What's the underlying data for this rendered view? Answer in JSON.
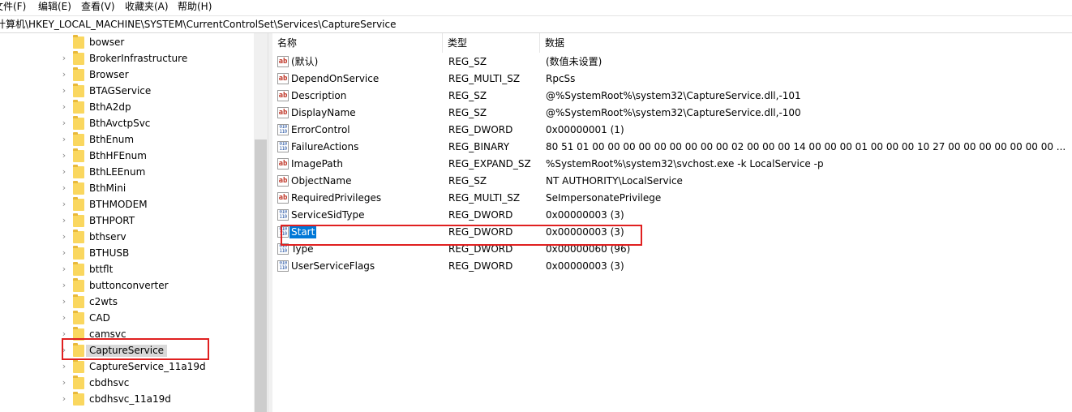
{
  "menu": [
    {
      "label": "文件(F)"
    },
    {
      "label": "编辑(E)"
    },
    {
      "label": "查看(V)"
    },
    {
      "label": "收藏夹(A)"
    },
    {
      "label": "帮助(H)"
    }
  ],
  "address_path": "计算机\\HKEY_LOCAL_MACHINE\\SYSTEM\\CurrentControlSet\\Services\\CaptureService",
  "tree": {
    "items": [
      {
        "label": "bowser",
        "expandable": false
      },
      {
        "label": "BrokerInfrastructure",
        "expandable": true
      },
      {
        "label": "Browser",
        "expandable": true
      },
      {
        "label": "BTAGService",
        "expandable": true
      },
      {
        "label": "BthA2dp",
        "expandable": true
      },
      {
        "label": "BthAvctpSvc",
        "expandable": true
      },
      {
        "label": "BthEnum",
        "expandable": true
      },
      {
        "label": "BthHFEnum",
        "expandable": true
      },
      {
        "label": "BthLEEnum",
        "expandable": true
      },
      {
        "label": "BthMini",
        "expandable": true
      },
      {
        "label": "BTHMODEM",
        "expandable": true
      },
      {
        "label": "BTHPORT",
        "expandable": true
      },
      {
        "label": "bthserv",
        "expandable": true
      },
      {
        "label": "BTHUSB",
        "expandable": true
      },
      {
        "label": "bttflt",
        "expandable": true
      },
      {
        "label": "buttonconverter",
        "expandable": true
      },
      {
        "label": "c2wts",
        "expandable": true
      },
      {
        "label": "CAD",
        "expandable": true
      },
      {
        "label": "camsvc",
        "expandable": true
      },
      {
        "label": "CaptureService",
        "expandable": true,
        "selected": true
      },
      {
        "label": "CaptureService_11a19d",
        "expandable": true
      },
      {
        "label": "cbdhsvc",
        "expandable": true
      },
      {
        "label": "cbdhsvc_11a19d",
        "expandable": true
      }
    ]
  },
  "columns": {
    "name": "名称",
    "type": "类型",
    "data": "数据"
  },
  "values": [
    {
      "icon": "string-value-icon",
      "name": "(默认)",
      "type": "REG_SZ",
      "data": "(数值未设置)"
    },
    {
      "icon": "string-value-icon",
      "name": "DependOnService",
      "type": "REG_MULTI_SZ",
      "data": "RpcSs"
    },
    {
      "icon": "string-value-icon",
      "name": "Description",
      "type": "REG_SZ",
      "data": "@%SystemRoot%\\system32\\CaptureService.dll,-101"
    },
    {
      "icon": "string-value-icon",
      "name": "DisplayName",
      "type": "REG_SZ",
      "data": "@%SystemRoot%\\system32\\CaptureService.dll,-100"
    },
    {
      "icon": "binary-value-icon",
      "name": "ErrorControl",
      "type": "REG_DWORD",
      "data": "0x00000001 (1)"
    },
    {
      "icon": "binary-value-icon",
      "name": "FailureActions",
      "type": "REG_BINARY",
      "data": "80 51 01 00 00 00 00 00 00 00 00 00 02 00 00 00 14 00 00 00 01 00 00 00 10 27 00 00 00 00 00 00 00 ..."
    },
    {
      "icon": "string-value-icon",
      "name": "ImagePath",
      "type": "REG_EXPAND_SZ",
      "data": "%SystemRoot%\\system32\\svchost.exe -k LocalService -p"
    },
    {
      "icon": "string-value-icon",
      "name": "ObjectName",
      "type": "REG_SZ",
      "data": "NT AUTHORITY\\LocalService"
    },
    {
      "icon": "string-value-icon",
      "name": "RequiredPrivileges",
      "type": "REG_MULTI_SZ",
      "data": "SeImpersonatePrivilege"
    },
    {
      "icon": "binary-value-icon",
      "name": "ServiceSidType",
      "type": "REG_DWORD",
      "data": "0x00000003 (3)"
    },
    {
      "icon": "binary-value-icon",
      "name": "Start",
      "type": "REG_DWORD",
      "data": "0x00000003 (3)",
      "selected": true
    },
    {
      "icon": "binary-value-icon",
      "name": "Type",
      "type": "REG_DWORD",
      "data": "0x00000060 (96)"
    },
    {
      "icon": "binary-value-icon",
      "name": "UserServiceFlags",
      "type": "REG_DWORD",
      "data": "0x00000003 (3)"
    }
  ],
  "colors": {
    "selection_blue": "#0078d7",
    "annotation_red": "#e02020",
    "folder_yellow": "#fad75f",
    "tree_selected_gray": "#d9d9d9"
  }
}
